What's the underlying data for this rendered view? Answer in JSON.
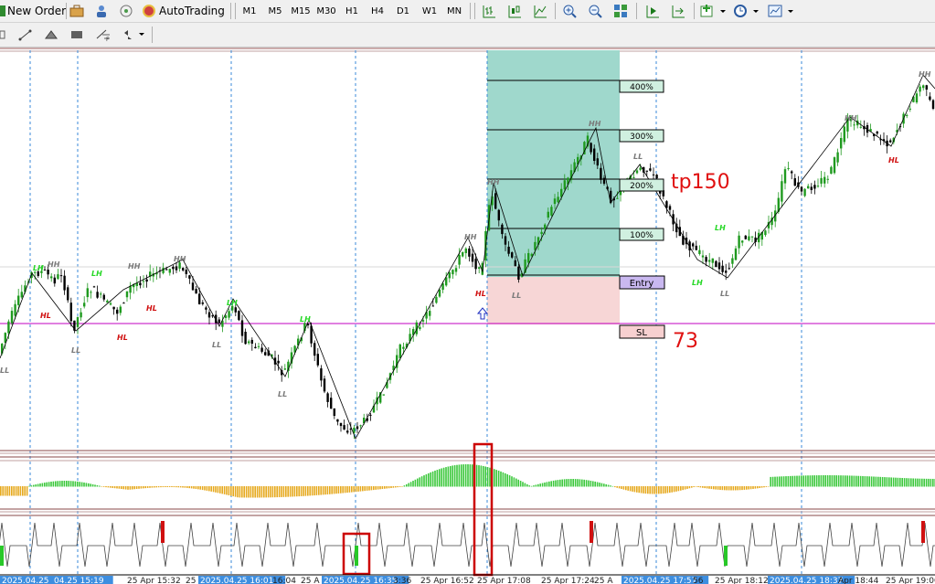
{
  "toolbar": {
    "new_order": "New Order",
    "autotrading": "AutoTrading",
    "timeframes": [
      "M1",
      "M5",
      "M15",
      "M30",
      "H1",
      "H4",
      "D1",
      "W1",
      "MN"
    ],
    "icons": [
      "new-order-icon",
      "briefcase-icon",
      "people-icon",
      "signal-icon",
      "autotrading-icon",
      "bar-chart-icon",
      "candlestick-icon",
      "line-chart-icon",
      "zoom-in-icon",
      "zoom-out-icon",
      "tile-windows-icon",
      "chart-shift-icon",
      "autoscroll-icon",
      "indicators-icon",
      "period-icon",
      "templates-icon"
    ]
  },
  "drawing_toolbar": {
    "icons": [
      "trendline-icon",
      "triangle-icon",
      "rectangle-icon",
      "fibo-icon",
      "arrows-icon"
    ]
  },
  "levels": {
    "fib": [
      "400%",
      "300%",
      "200%",
      "100%"
    ],
    "entry": "Entry",
    "sl": "SL",
    "tp_annotation": "tp150",
    "sl_annotation": "73"
  },
  "swing_labels": [
    {
      "t": "LL",
      "c": "#7a7a7a"
    },
    {
      "t": "LH",
      "c": "#27d827"
    },
    {
      "t": "HH",
      "c": "#7a7a7a"
    },
    {
      "t": "HL",
      "c": "#d01010"
    },
    {
      "t": "LL",
      "c": "#7a7a7a"
    },
    {
      "t": "LH",
      "c": "#27d827"
    },
    {
      "t": "HH",
      "c": "#7a7a7a"
    },
    {
      "t": "HL",
      "c": "#d01010"
    },
    {
      "t": "HH",
      "c": "#7a7a7a"
    },
    {
      "t": "HL",
      "c": "#d01010"
    },
    {
      "t": "LH",
      "c": "#27d827"
    },
    {
      "t": "LL",
      "c": "#7a7a7a"
    },
    {
      "t": "LH",
      "c": "#27d827"
    },
    {
      "t": "LL",
      "c": "#7a7a7a"
    },
    {
      "t": "HH",
      "c": "#7a7a7a"
    },
    {
      "t": "HL",
      "c": "#d01010"
    },
    {
      "t": "HH",
      "c": "#7a7a7a"
    },
    {
      "t": "LL",
      "c": "#7a7a7a"
    },
    {
      "t": "HH",
      "c": "#7a7a7a"
    },
    {
      "t": "LH",
      "c": "#27d827"
    },
    {
      "t": "LL",
      "c": "#7a7a7a"
    },
    {
      "t": "LH",
      "c": "#27d827"
    },
    {
      "t": "LL",
      "c": "#7a7a7a"
    },
    {
      "t": "HH",
      "c": "#7a7a7a"
    },
    {
      "t": "HL",
      "c": "#d01010"
    },
    {
      "t": "HH",
      "c": "#7a7a7a"
    }
  ],
  "time_axis": [
    {
      "t": "2025.04.25 15:06",
      "hl": true
    },
    {
      "t": "04.25 15:19",
      "hl": true
    },
    {
      "t": "25 Apr 15:32",
      "hl": false
    },
    {
      "t": "25",
      "hl": false
    },
    {
      "t": "2025.04.25 16:01",
      "hl": true
    },
    {
      "t": "16:04",
      "hl": false
    },
    {
      "t": "25 A",
      "hl": false
    },
    {
      "t": "2025.04.25 16:35",
      "hl": true
    },
    {
      "t": "3:36",
      "hl": false
    },
    {
      "t": "25 Apr 16:52",
      "hl": false
    },
    {
      "t": "25 Apr 17:08",
      "hl": false
    },
    {
      "t": "25 Apr 17:24",
      "hl": false
    },
    {
      "t": "25 A",
      "hl": false
    },
    {
      "t": "2025.04.25 17:57",
      "hl": true
    },
    {
      "t": "56",
      "hl": false
    },
    {
      "t": "25 Apr 18:12",
      "hl": false
    },
    {
      "t": "2025.04.25 18:37",
      "hl": true
    },
    {
      "t": "Apr 18:44",
      "hl": false
    },
    {
      "t": "25 Apr 19:00",
      "hl": false
    }
  ],
  "colors": {
    "bull": "#1f9a1f",
    "bear": "#000000",
    "tp_zone": "#9fd8cc",
    "sl_zone": "#f7d6d6",
    "sl_line": "#c000c0",
    "osc_up": "#3cc83c",
    "osc_down": "#e6a91e",
    "highlight": "#cc0000",
    "axis_hl": "#3d8ee0",
    "entry_box": "#c9b8f0",
    "sl_box": "#f7d0d0",
    "fib_box": "#d0f0e0"
  }
}
